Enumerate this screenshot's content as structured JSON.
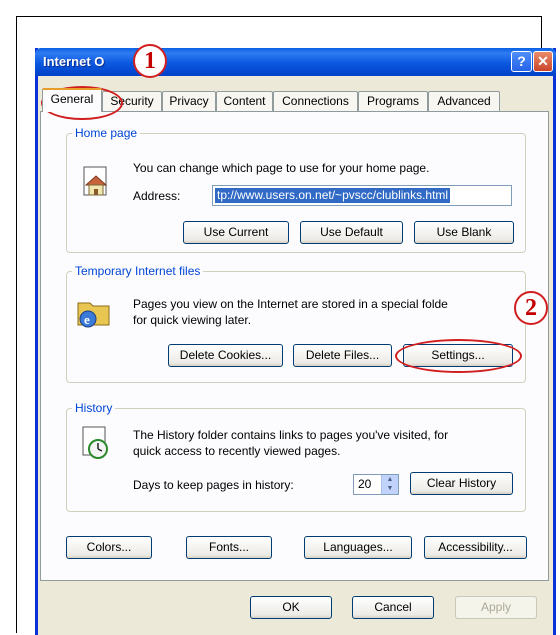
{
  "window": {
    "title": "Internet O",
    "help_glyph": "?",
    "close_glyph": "✕"
  },
  "tabs": [
    {
      "label": "General"
    },
    {
      "label": "Security"
    },
    {
      "label": "Privacy"
    },
    {
      "label": "Content"
    },
    {
      "label": "Connections"
    },
    {
      "label": "Programs"
    },
    {
      "label": "Advanced"
    }
  ],
  "home_page": {
    "group_label": "Home page",
    "description": "You can change which page to use for your home page.",
    "address_label": "Address:",
    "address_value": "tp://www.users.on.net/~pvscc/clublinks.html",
    "buttons": {
      "use_current": "Use Current",
      "use_default": "Use Default",
      "use_blank": "Use Blank"
    }
  },
  "temp_files": {
    "group_label": "Temporary Internet files",
    "description_line1": "Pages you view on the Internet are stored in a special folde",
    "description_line2": "for quick viewing later.",
    "buttons": {
      "delete_cookies": "Delete Cookies...",
      "delete_files": "Delete Files...",
      "settings": "Settings..."
    }
  },
  "history": {
    "group_label": "History",
    "description_line1": "The History folder contains links to pages you've visited, for",
    "description_line2": "quick access to recently viewed pages.",
    "days_label": "Days to keep pages in history:",
    "days_value": "20",
    "clear_button": "Clear History"
  },
  "bottom_buttons": {
    "colors": "Colors...",
    "fonts": "Fonts...",
    "languages": "Languages...",
    "accessibility": "Accessibility..."
  },
  "dialog_buttons": {
    "ok": "OK",
    "cancel": "Cancel",
    "apply": "Apply"
  },
  "annotations": {
    "step1": "1",
    "step2": "2"
  },
  "colors": {
    "annotation": "#d11f1f",
    "titlebar": "#0a5fe3",
    "group_label": "#0046d5"
  }
}
